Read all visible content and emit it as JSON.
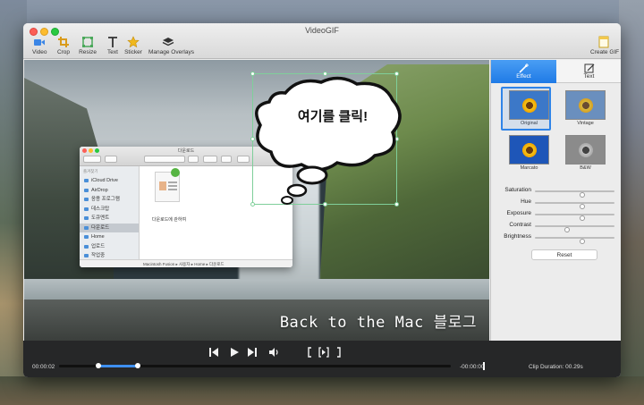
{
  "window": {
    "title": "VideoGIF"
  },
  "toolbar": {
    "video": "Video",
    "crop": "Crop",
    "resize": "Resize",
    "text": "Text",
    "sticker": "Sticker",
    "manage_overlays": "Manage Overlays",
    "create_gif": "Create GIF"
  },
  "preview": {
    "bubble_text": "여기를 클릭!",
    "caption": "Back to the Mac 블로그"
  },
  "finder": {
    "title": "다운로드",
    "sidebar_header": "즐겨찾기",
    "sidebar_items": [
      "iCloud Drive",
      "AirDrop",
      "응용 프로그램",
      "데스크탑",
      "도큐멘트",
      "다운로드",
      "Home",
      "업로드",
      "작업중"
    ],
    "file_label": "다운로드에 관하여",
    "path": "Macintosh Fusion ▸ 사용자 ▸ Home ▸ 다운로드"
  },
  "panel": {
    "tab_effect": "Effect",
    "tab_text": "Text",
    "filters": [
      "Original",
      "Vintage",
      "Marcato",
      "B&W"
    ],
    "sliders": [
      {
        "label": "Saturation",
        "value": 0.6
      },
      {
        "label": "Hue",
        "value": 0.6
      },
      {
        "label": "Exposure",
        "value": 0.6
      },
      {
        "label": "Contrast",
        "value": 0.4
      },
      {
        "label": "Brightness",
        "value": 0.6
      }
    ],
    "reset": "Reset"
  },
  "transport": {
    "time_start": "00:00:02",
    "time_end": "-00:00:00",
    "clip_duration": "Clip Duration: 00.29s",
    "trim_start": 0.1,
    "trim_end": 0.2
  },
  "colors": {
    "accent": "#2f84e8",
    "transport_bg": "#262728"
  }
}
